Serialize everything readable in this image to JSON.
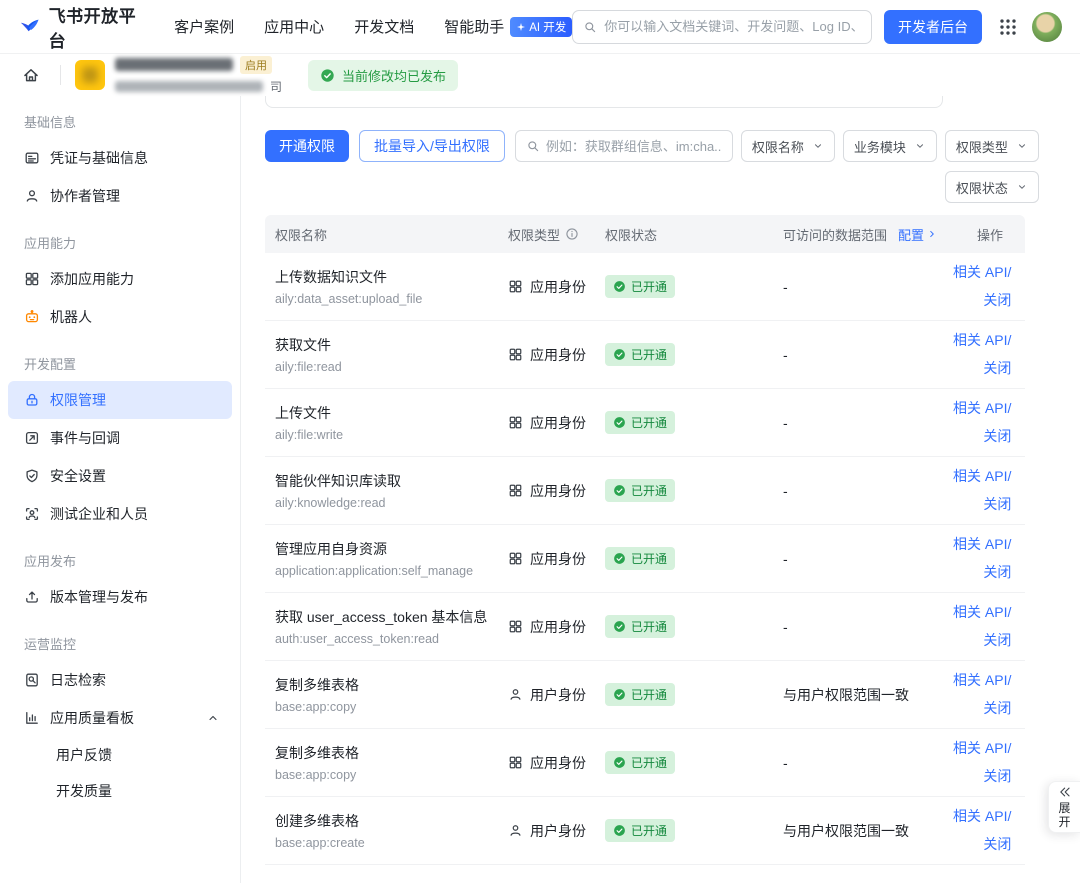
{
  "colors": {
    "accent": "#3370ff",
    "success": "#34a853",
    "success_badge_bg": "#d5f1dc",
    "active_item_bg": "#e1eaff"
  },
  "topnav": {
    "logo_text": "飞书开放平台",
    "nav_items": [
      "客户案例",
      "应用中心",
      "开发文档",
      "智能助手"
    ],
    "ai_badge": "AI 开发",
    "search_placeholder": "你可以输入文档关键词、开发问题、Log ID、错误码",
    "console_button": "开发者后台"
  },
  "appbar": {
    "enabled_badge": "启用",
    "masked_name_suffix": "司",
    "published_badge": "当前修改均已发布"
  },
  "sidebar": {
    "sections": [
      {
        "label": "基础信息",
        "items": [
          {
            "id": "credentials",
            "icon": "id-card",
            "label": "凭证与基础信息"
          },
          {
            "id": "collaborators",
            "icon": "person",
            "label": "协作者管理"
          }
        ]
      },
      {
        "label": "应用能力",
        "items": [
          {
            "id": "add-capability",
            "icon": "grid",
            "label": "添加应用能力"
          },
          {
            "id": "bot",
            "icon": "robot",
            "label": "机器人"
          }
        ]
      },
      {
        "label": "开发配置",
        "items": [
          {
            "id": "permissions",
            "icon": "lock",
            "label": "权限管理",
            "active": true
          },
          {
            "id": "events",
            "icon": "event",
            "label": "事件与回调"
          },
          {
            "id": "security",
            "icon": "shield",
            "label": "安全设置"
          },
          {
            "id": "test-org",
            "icon": "test",
            "label": "测试企业和人员"
          }
        ]
      },
      {
        "label": "应用发布",
        "items": [
          {
            "id": "release",
            "icon": "publish",
            "label": "版本管理与发布"
          }
        ]
      },
      {
        "label": "运营监控",
        "items": [
          {
            "id": "logs",
            "icon": "log",
            "label": "日志检索"
          },
          {
            "id": "quality",
            "icon": "chart",
            "label": "应用质量看板",
            "expandable": true,
            "children": [
              "用户反馈",
              "开发质量"
            ]
          }
        ]
      }
    ]
  },
  "main": {
    "toolbar": {
      "open_button": "开通权限",
      "batch_button": "批量导入/导出权限"
    },
    "filters": {
      "search_placeholder": "例如：获取群组信息、im:cha...",
      "dropdowns": [
        "权限名称",
        "业务模块",
        "权限类型",
        "权限状态"
      ]
    },
    "table": {
      "headers": {
        "name": "权限名称",
        "type": "权限类型",
        "status": "权限状态",
        "scope": "可访问的数据范围",
        "config_link": "配置",
        "actions": "操作"
      },
      "type_labels": {
        "app": "应用身份",
        "user": "用户身份"
      },
      "action_api": "相关 API/",
      "action_close": "关闭",
      "rows": [
        {
          "name": "上传数据知识文件",
          "code": "aily:data_asset:upload_file",
          "type": "app",
          "status": "已开通",
          "scope": "-"
        },
        {
          "name": "获取文件",
          "code": "aily:file:read",
          "type": "app",
          "status": "已开通",
          "scope": "-"
        },
        {
          "name": "上传文件",
          "code": "aily:file:write",
          "type": "app",
          "status": "已开通",
          "scope": "-"
        },
        {
          "name": "智能伙伴知识库读取",
          "code": "aily:knowledge:read",
          "type": "app",
          "status": "已开通",
          "scope": "-"
        },
        {
          "name": "管理应用自身资源",
          "code": "application:application:self_manage",
          "type": "app",
          "status": "已开通",
          "scope": "-"
        },
        {
          "name": "获取 user_access_token 基本信息",
          "code": "auth:user_access_token:read",
          "type": "app",
          "status": "已开通",
          "scope": "-"
        },
        {
          "name": "复制多维表格",
          "code": "base:app:copy",
          "type": "user",
          "status": "已开通",
          "scope": "与用户权限范围一致"
        },
        {
          "name": "复制多维表格",
          "code": "base:app:copy",
          "type": "app",
          "status": "已开通",
          "scope": "-"
        },
        {
          "name": "创建多维表格",
          "code": "base:app:create",
          "type": "user",
          "status": "已开通",
          "scope": "与用户权限范围一致"
        }
      ]
    }
  },
  "expand_panel": {
    "label": "展开"
  }
}
